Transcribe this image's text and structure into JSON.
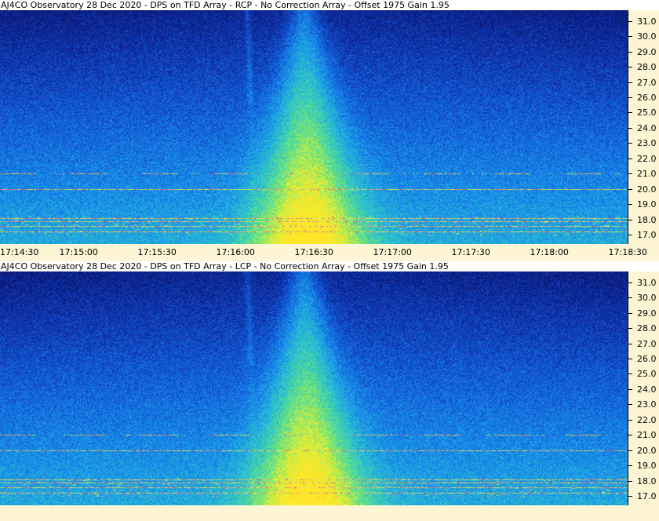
{
  "chart_data": [
    {
      "type": "heatmap",
      "title": "AJ4CO Observatory 28 Dec 2020 - DPS on TFD Array  - RCP  -  No Correction Array  -  Offset 1975  Gain 1.95",
      "yticks": [
        "31.0",
        "30.0",
        "29.0",
        "28.0",
        "27.0",
        "26.0",
        "25.0",
        "24.0",
        "23.0",
        "22.0",
        "21.0",
        "20.0",
        "19.0",
        "18.0",
        "17.0"
      ],
      "xticks": [
        "17:14:30",
        "17:15:00",
        "17:15:30",
        "17:16:00",
        "17:16:30",
        "17:17:00",
        "17:17:30",
        "17:18:00",
        "17:18:30"
      ],
      "ylim": [
        16.4,
        31.7
      ],
      "xlim": [
        "17:14:30",
        "17:18:30"
      ],
      "burst_center_time": "17:16:27",
      "interference_bands_mhz": [
        21.0,
        20.0,
        18.1,
        17.9,
        17.6,
        17.2
      ]
    },
    {
      "type": "heatmap",
      "title": "AJ4CO Observatory 28 Dec 2020 - DPS on TFD Array  - LCP  -  No Correction Array  -  Offset 1975  Gain 1.95",
      "yticks": [
        "31.0",
        "30.0",
        "29.0",
        "28.0",
        "27.0",
        "26.0",
        "25.0",
        "24.0",
        "23.0",
        "22.0",
        "21.0",
        "20.0",
        "19.0",
        "18.0",
        "17.0"
      ],
      "ylim": [
        16.4,
        31.7
      ],
      "xlim": [
        "17:14:30",
        "17:18:30"
      ],
      "burst_center_time": "17:16:27",
      "interference_bands_mhz": [
        21.0,
        20.0,
        18.1,
        17.9,
        17.6,
        17.2
      ]
    }
  ]
}
